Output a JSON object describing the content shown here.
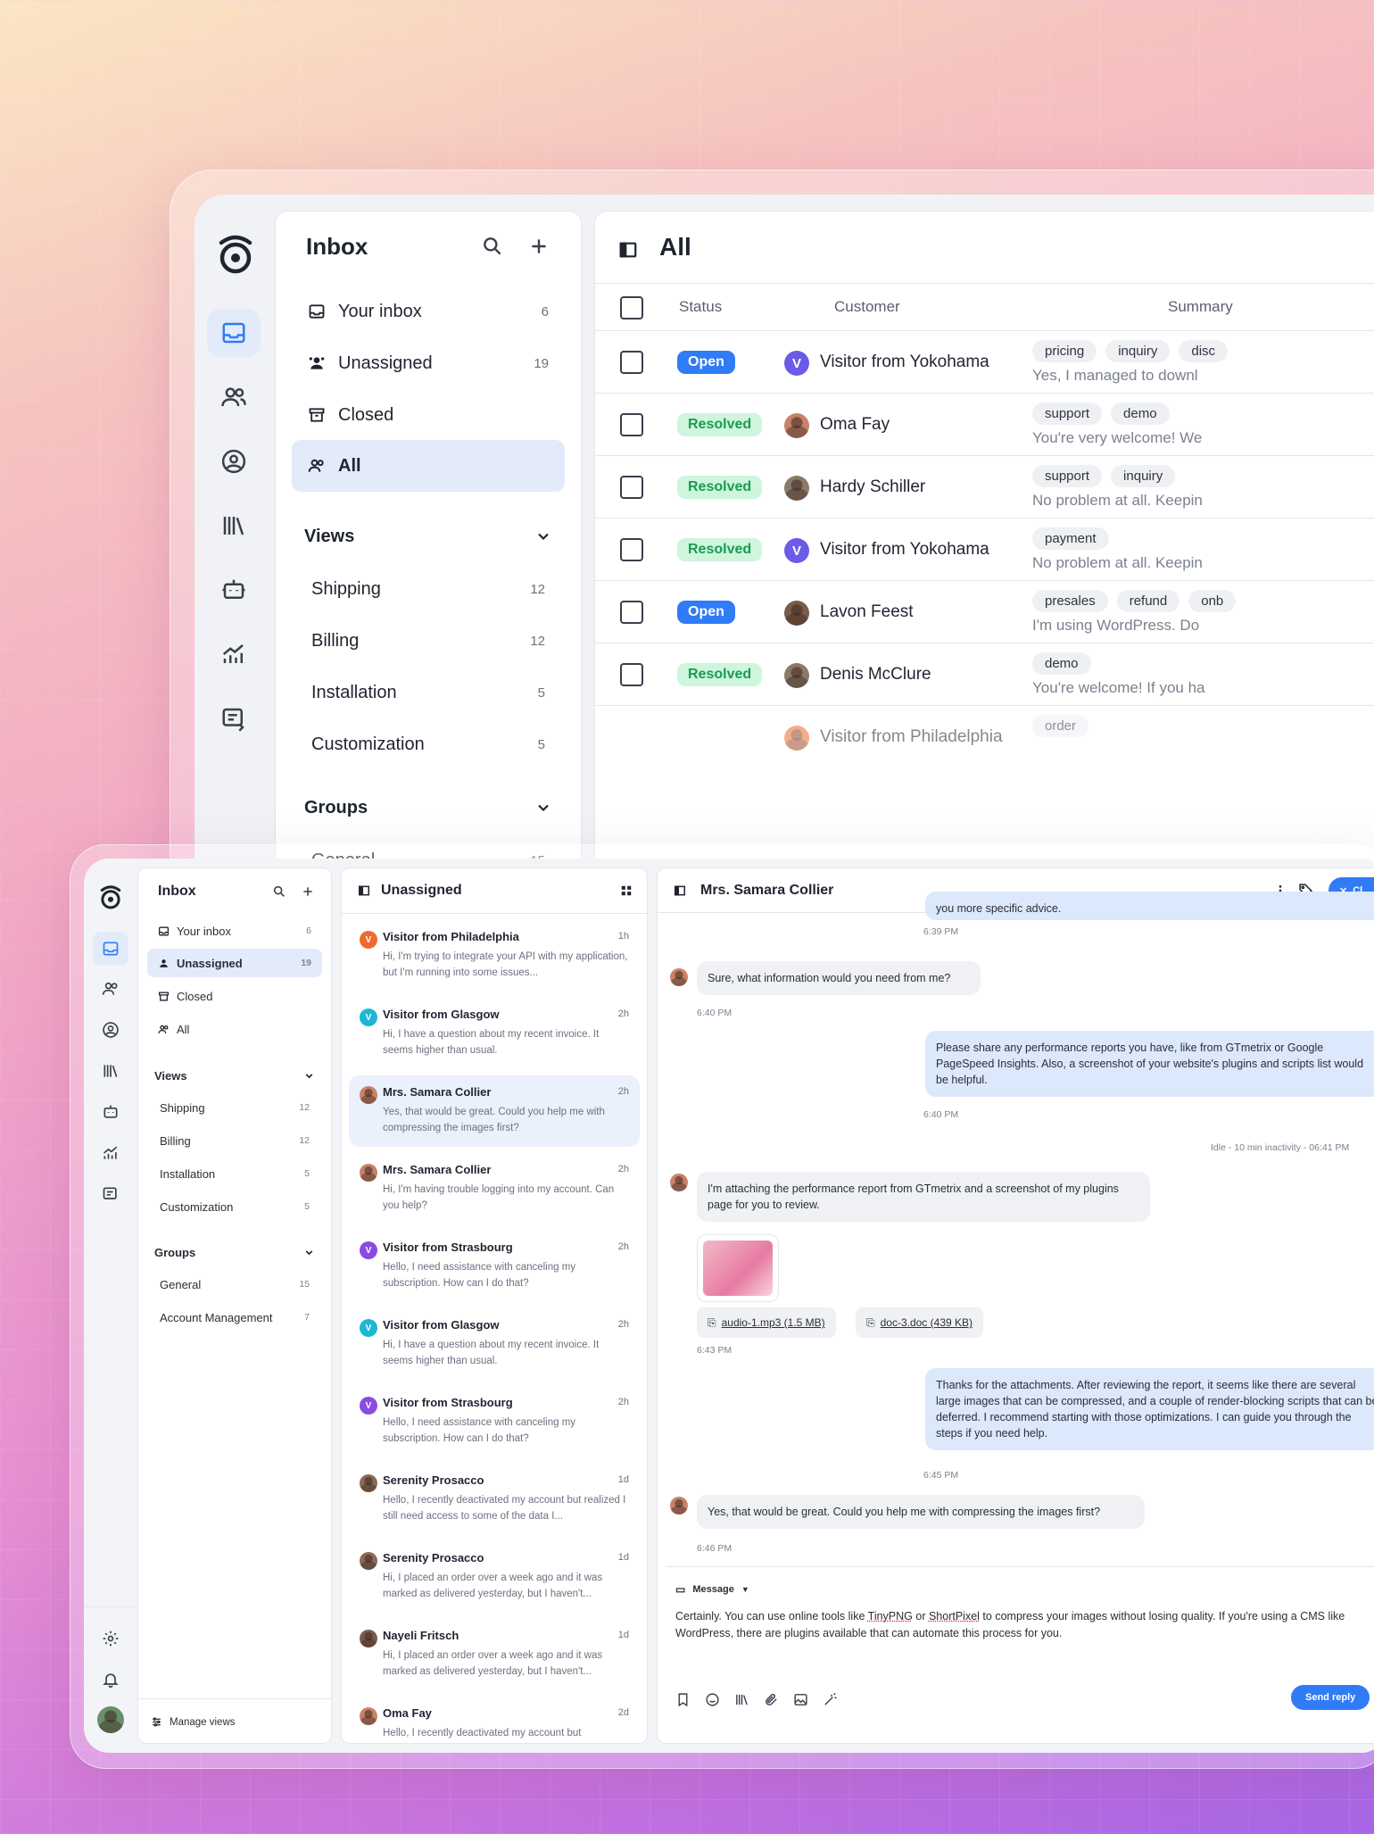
{
  "back": {
    "sidebar": {
      "title": "Inbox",
      "items": [
        {
          "label": "Your inbox",
          "count": "6",
          "icon": "inbox-icon"
        },
        {
          "label": "Unassigned",
          "count": "19",
          "icon": "unassigned-icon"
        },
        {
          "label": "Closed",
          "count": "",
          "icon": "archive-icon"
        },
        {
          "label": "All",
          "count": "",
          "icon": "users-icon"
        }
      ],
      "views_title": "Views",
      "views": [
        {
          "label": "Shipping",
          "count": "12"
        },
        {
          "label": "Billing",
          "count": "12"
        },
        {
          "label": "Installation",
          "count": "5"
        },
        {
          "label": "Customization",
          "count": "5"
        }
      ],
      "groups_title": "Groups",
      "groups": [
        {
          "label": "General",
          "count": "15"
        }
      ]
    },
    "main": {
      "title": "All",
      "columns": [
        "Status",
        "Customer",
        "Summary"
      ],
      "rows": [
        {
          "status": "Open",
          "customer": "Visitor from Yokohama",
          "avatar_letter": "V",
          "tags": [
            "pricing",
            "inquiry",
            "disc"
          ],
          "summary": "Yes, I managed to downl"
        },
        {
          "status": "Resolved",
          "customer": "Oma Fay",
          "avatar_letter": "",
          "tags": [
            "support",
            "demo"
          ],
          "summary": "You're very welcome! We"
        },
        {
          "status": "Resolved",
          "customer": "Hardy Schiller",
          "avatar_letter": "",
          "tags": [
            "support",
            "inquiry"
          ],
          "summary": "No problem at all. Keepin"
        },
        {
          "status": "Resolved",
          "customer": "Visitor from Yokohama",
          "avatar_letter": "V",
          "tags": [
            "payment"
          ],
          "summary": "No problem at all. Keepin"
        },
        {
          "status": "Open",
          "customer": "Lavon Feest",
          "avatar_letter": "",
          "tags": [
            "presales",
            "refund",
            "onb"
          ],
          "summary": "I'm using WordPress. Do"
        },
        {
          "status": "Resolved",
          "customer": "Denis McClure",
          "avatar_letter": "",
          "tags": [
            "demo"
          ],
          "summary": "You're welcome! If you ha"
        }
      ],
      "partial_row": {
        "customer": "Visitor from Philadelphia",
        "tag": "order"
      }
    }
  },
  "front": {
    "sidebar": {
      "title": "Inbox",
      "items": [
        {
          "label": "Your inbox",
          "count": "6"
        },
        {
          "label": "Unassigned",
          "count": "19"
        },
        {
          "label": "Closed",
          "count": ""
        },
        {
          "label": "All",
          "count": ""
        }
      ],
      "views_title": "Views",
      "views": [
        {
          "label": "Shipping",
          "count": "12"
        },
        {
          "label": "Billing",
          "count": "12"
        },
        {
          "label": "Installation",
          "count": "5"
        },
        {
          "label": "Customization",
          "count": "5"
        }
      ],
      "groups_title": "Groups",
      "groups": [
        {
          "label": "General",
          "count": "15"
        },
        {
          "label": "Account Management",
          "count": "7"
        }
      ],
      "manage_views": "Manage views"
    },
    "list": {
      "title": "Unassigned",
      "items": [
        {
          "name": "Visitor from Philadelphia",
          "time": "1h",
          "letter": "V",
          "color": "#f06a2e",
          "preview": "Hi, I'm trying to integrate your API with my application, but I'm running into some issues..."
        },
        {
          "name": "Visitor from Glasgow",
          "time": "2h",
          "letter": "V",
          "color": "#1cb7d6",
          "preview": "Hi, I have a question about my recent invoice. It seems higher than usual."
        },
        {
          "name": "Mrs. Samara Collier",
          "time": "2h",
          "letter": "",
          "color": "#c9826a",
          "preview": "Yes, that would be great. Could you help me with compressing the images first?"
        },
        {
          "name": "Mrs. Samara Collier",
          "time": "2h",
          "letter": "",
          "color": "#c9826a",
          "preview": "Hi, I'm having trouble logging into my account. Can you help?"
        },
        {
          "name": "Visitor from Strasbourg",
          "time": "2h",
          "letter": "V",
          "color": "#8a4be0",
          "preview": "Hello, I need assistance with canceling my subscription. How can I do that?"
        },
        {
          "name": "Visitor from Glasgow",
          "time": "2h",
          "letter": "V",
          "color": "#1cb7d6",
          "preview": "Hi, I have a question about my recent invoice. It seems higher than usual."
        },
        {
          "name": "Visitor from Strasbourg",
          "time": "2h",
          "letter": "V",
          "color": "#8a4be0",
          "preview": "Hello, I need assistance with canceling my subscription. How can I do that?"
        },
        {
          "name": "Serenity Prosacco",
          "time": "1d",
          "letter": "",
          "color": "#8c6a55",
          "preview": "Hello, I recently deactivated my account but realized I still need access to some of the data I..."
        },
        {
          "name": "Serenity Prosacco",
          "time": "1d",
          "letter": "",
          "color": "#8c6a55",
          "preview": "Hi, I placed an order over a week ago and it was marked as delivered yesterday, but I haven't..."
        },
        {
          "name": "Nayeli Fritsch",
          "time": "1d",
          "letter": "",
          "color": "#7a5c4a",
          "preview": "Hi, I placed an order over a week ago and it was marked as delivered yesterday, but I haven't..."
        },
        {
          "name": "Oma Fay",
          "time": "2d",
          "letter": "",
          "color": "#c9826a",
          "preview": "Hello, I recently deactivated my account but"
        }
      ]
    },
    "chat": {
      "title": "Mrs. Samara Collier",
      "close_label": "Cl",
      "top_fragment": "you more specific advice.",
      "top_time": "6:39 PM",
      "m1": "Sure, what information would you need from me?",
      "m1_time": "6:40 PM",
      "m2": "Please share any performance reports you have, like from GTmetrix or Google PageSpeed Insights. Also, a screenshot of your website's plugins and scripts list would be helpful.",
      "m2_time": "6:40 PM",
      "idle": "Idle - 10 min inactivity - 06:41 PM",
      "m3": "I'm attaching the performance report from GTmetrix and a screenshot of my plugins page for you to review.",
      "att1": "audio-1.mp3 (1.5 MB)",
      "att2": "doc-3.doc (439 KB)",
      "m3_time": "6:43 PM",
      "m4": "Thanks for the attachments. After reviewing the report, it seems like there are several large images that can be compressed, and a couple of render-blocking scripts that can be deferred. I recommend starting with those optimizations. I can guide you through the steps if you need help.",
      "m4_time": "6:45 PM",
      "m5": "Yes, that would be great. Could you help me with compressing the images first?",
      "m5_time": "6:46 PM",
      "composer_mode": "Message",
      "draft_a": "Certainly. You can use online tools like ",
      "draft_link1": "TinyPNG",
      "draft_b": " or ",
      "draft_link2": "ShortPixel",
      "draft_c": " to compress your images without losing quality. If you're using a CMS like WordPress, there are plugins available that can automate this process for you.",
      "send_label": "Send reply"
    }
  }
}
